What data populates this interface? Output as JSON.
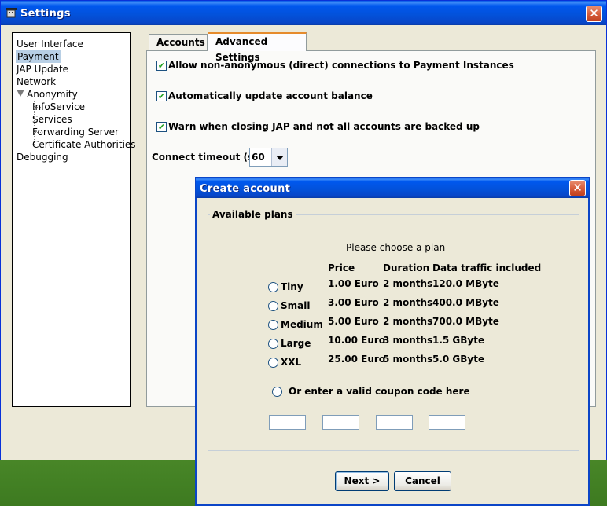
{
  "window": {
    "title": "Settings"
  },
  "tree": {
    "items": [
      "User Interface",
      "Payment",
      "JAP Update",
      "Network",
      "Anonymity"
    ],
    "children": [
      "InfoService",
      "Services",
      "Forwarding Server",
      "Certificate Authorities"
    ],
    "last": "Debugging",
    "selected": "Payment"
  },
  "tabs": [
    "Accounts",
    "Advanced Settings"
  ],
  "options": [
    {
      "label": "Allow non-anonymous (direct) connections to Payment Instances",
      "checked": true
    },
    {
      "label": "Automatically update account balance",
      "checked": true
    },
    {
      "label": "Warn when closing JAP and not all accounts are backed up",
      "checked": true
    }
  ],
  "timeout": {
    "label": "Connect timeout (s):",
    "value": "60"
  },
  "dialog": {
    "title": "Create account",
    "group_label": "Available plans",
    "prompt": "Please choose a plan",
    "headers": [
      "Price",
      "Duration",
      "Data traffic included"
    ],
    "plans": [
      {
        "name": "Tiny",
        "price": "1.00 Euro",
        "duration": "2 months",
        "traffic": "120.0 MByte"
      },
      {
        "name": "Small",
        "price": "3.00 Euro",
        "duration": "2 months",
        "traffic": "400.0 MByte"
      },
      {
        "name": "Medium",
        "price": "5.00 Euro",
        "duration": "2 months",
        "traffic": "700.0 MByte"
      },
      {
        "name": "Large",
        "price": "10.00 Euro",
        "duration": "3 months",
        "traffic": "1.5 GByte"
      },
      {
        "name": "XXL",
        "price": "25.00 Euro",
        "duration": "5 months",
        "traffic": "5.0 GByte"
      }
    ],
    "coupon_label": "Or enter a valid coupon code here",
    "coupon_separator": "-",
    "next_label": "Next >",
    "cancel_label": "Cancel"
  },
  "icons": {
    "app": "jap-icon",
    "close": "close-icon",
    "check": "check-icon"
  }
}
